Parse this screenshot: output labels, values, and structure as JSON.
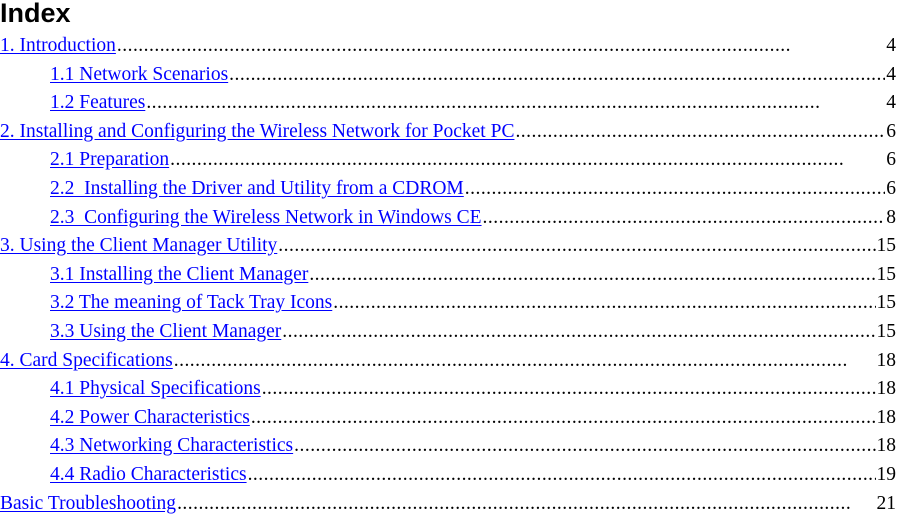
{
  "title": "Index",
  "entries": [
    {
      "label": "1. Introduction",
      "page": "4",
      "level": 1
    },
    {
      "label": "1.1 Network Scenarios",
      "page": "4",
      "level": 2
    },
    {
      "label": "1.2 Features",
      "page": "4",
      "level": 2
    },
    {
      "label": "2. Installing and Configuring the Wireless Network for Pocket PC",
      "page": "6",
      "level": 1
    },
    {
      "label": "2.1 Preparation",
      "page": "6",
      "level": 2
    },
    {
      "label": "2.2  Installing the Driver and Utility from a CDROM",
      "page": "6",
      "level": 2
    },
    {
      "label": "2.3  Configuring the Wireless Network in Windows CE",
      "page": "8",
      "level": 2
    },
    {
      "label": "3. Using the Client Manager Utility",
      "page": "15",
      "level": 1
    },
    {
      "label": "3.1 Installing the Client Manager",
      "page": "15",
      "level": 2
    },
    {
      "label": "3.2 The meaning of Tack Tray Icons",
      "page": "15",
      "level": 2
    },
    {
      "label": "3.3 Using the Client Manager",
      "page": "15",
      "level": 2
    },
    {
      "label": "4. Card Specifications",
      "page": "18",
      "level": 1
    },
    {
      "label": "4.1 Physical Specifications",
      "page": "18",
      "level": 2
    },
    {
      "label": "4.2 Power Characteristics",
      "page": "18",
      "level": 2
    },
    {
      "label": "4.3 Networking Characteristics",
      "page": "18",
      "level": 2
    },
    {
      "label": "4.4 Radio Characteristics",
      "page": "19",
      "level": 2
    },
    {
      "label": "Basic Troubleshooting",
      "page": "21",
      "level": 1
    }
  ]
}
